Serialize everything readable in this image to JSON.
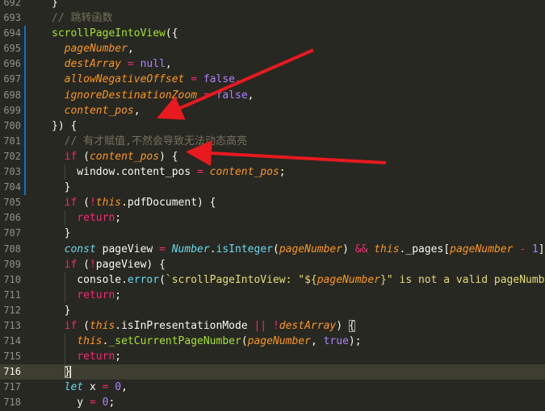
{
  "theme": {
    "background": "#272822",
    "keyword": "#f92672",
    "function": "#a6e22e",
    "param": "#fd971f",
    "constant": "#ae81ff",
    "string": "#e6db74",
    "comment": "#75715e",
    "type": "#66d9ef",
    "arrow": "#e8191f"
  },
  "editor": {
    "current_line": "716",
    "lines": [
      {
        "num": "692",
        "mark": false,
        "guides": [],
        "tokens": [
          {
            "t": "}",
            "c": "#f8f8f2"
          }
        ]
      },
      {
        "num": "693",
        "mark": false,
        "guides": [],
        "tokens": [
          {
            "t": "// 跳转函数",
            "c": "#75715e"
          }
        ]
      },
      {
        "num": "694",
        "mark": true,
        "guides": [],
        "tokens": [
          {
            "t": "scrollPageIntoView",
            "c": "#a6e22e"
          },
          {
            "t": "({",
            "c": "#f8f8f2"
          }
        ]
      },
      {
        "num": "695",
        "mark": true,
        "guides": [],
        "tokens": [
          {
            "t": "  "
          },
          {
            "t": "pageNumber",
            "c": "#fd971f",
            "i": true
          },
          {
            "t": ","
          }
        ]
      },
      {
        "num": "696",
        "mark": true,
        "guides": [],
        "tokens": [
          {
            "t": "  "
          },
          {
            "t": "destArray",
            "c": "#fd971f",
            "i": true
          },
          {
            "t": " = ",
            "c": "#f92672"
          },
          {
            "t": "null",
            "c": "#ae81ff"
          },
          {
            "t": ","
          }
        ]
      },
      {
        "num": "697",
        "mark": true,
        "guides": [],
        "tokens": [
          {
            "t": "  "
          },
          {
            "t": "allowNegativeOffset",
            "c": "#fd971f",
            "i": true
          },
          {
            "t": " = ",
            "c": "#f92672"
          },
          {
            "t": "false",
            "c": "#ae81ff"
          },
          {
            "t": ","
          }
        ]
      },
      {
        "num": "698",
        "mark": true,
        "guides": [],
        "tokens": [
          {
            "t": "  "
          },
          {
            "t": "ignoreDestinationZoom",
            "c": "#fd971f",
            "i": true
          },
          {
            "t": " = ",
            "c": "#f92672"
          },
          {
            "t": "false",
            "c": "#ae81ff"
          },
          {
            "t": ","
          }
        ]
      },
      {
        "num": "699",
        "mark": true,
        "guides": [],
        "tokens": [
          {
            "t": "  "
          },
          {
            "t": "content_pos",
            "c": "#fd971f",
            "i": true
          },
          {
            "t": ","
          }
        ]
      },
      {
        "num": "700",
        "mark": true,
        "guides": [],
        "tokens": [
          {
            "t": "}) {"
          }
        ]
      },
      {
        "num": "701",
        "mark": true,
        "guides": [],
        "tokens": [
          {
            "t": "  "
          },
          {
            "t": "// 有才赋值,不然会导致无法动态高亮",
            "c": "#75715e"
          }
        ]
      },
      {
        "num": "702",
        "mark": true,
        "guides": [],
        "tokens": [
          {
            "t": "  "
          },
          {
            "t": "if",
            "c": "#f92672"
          },
          {
            "t": " ("
          },
          {
            "t": "content_pos",
            "c": "#fd971f",
            "i": true
          },
          {
            "t": ") {"
          }
        ]
      },
      {
        "num": "703",
        "mark": true,
        "guides": [
          1
        ],
        "tokens": [
          {
            "t": "    window.content_pos "
          },
          {
            "t": "=",
            "c": "#f92672"
          },
          {
            "t": " "
          },
          {
            "t": "content_pos",
            "c": "#fd971f",
            "i": true
          },
          {
            "t": ";"
          }
        ]
      },
      {
        "num": "704",
        "mark": true,
        "guides": [],
        "tokens": [
          {
            "t": "  }"
          }
        ]
      },
      {
        "num": "705",
        "mark": false,
        "guides": [],
        "tokens": [
          {
            "t": "  "
          },
          {
            "t": "if",
            "c": "#f92672"
          },
          {
            "t": " ("
          },
          {
            "t": "!",
            "c": "#f92672"
          },
          {
            "t": "this",
            "c": "#fd971f",
            "i": true
          },
          {
            "t": ".pdfDocument) {"
          }
        ]
      },
      {
        "num": "706",
        "mark": false,
        "guides": [
          1
        ],
        "tokens": [
          {
            "t": "    "
          },
          {
            "t": "return",
            "c": "#f92672"
          },
          {
            "t": ";"
          }
        ]
      },
      {
        "num": "707",
        "mark": false,
        "guides": [],
        "tokens": [
          {
            "t": "  }"
          }
        ]
      },
      {
        "num": "708",
        "mark": false,
        "guides": [],
        "tokens": [
          {
            "t": "  "
          },
          {
            "t": "const",
            "c": "#66d9ef",
            "i": true
          },
          {
            "t": " pageView "
          },
          {
            "t": "=",
            "c": "#f92672"
          },
          {
            "t": " "
          },
          {
            "t": "Number",
            "c": "#66d9ef",
            "i": true
          },
          {
            "t": "."
          },
          {
            "t": "isInteger",
            "c": "#66d9ef"
          },
          {
            "t": "("
          },
          {
            "t": "pageNumber",
            "c": "#fd971f",
            "i": true
          },
          {
            "t": ") "
          },
          {
            "t": "&&",
            "c": "#f92672"
          },
          {
            "t": " "
          },
          {
            "t": "this",
            "c": "#fd971f",
            "i": true
          },
          {
            "t": "._pages["
          },
          {
            "t": "pageNumber",
            "c": "#fd971f",
            "i": true
          },
          {
            "t": " - ",
            "c": "#f92672"
          },
          {
            "t": "1",
            "c": "#ae81ff"
          },
          {
            "t": "];"
          }
        ]
      },
      {
        "num": "709",
        "mark": false,
        "guides": [],
        "tokens": [
          {
            "t": "  "
          },
          {
            "t": "if",
            "c": "#f92672"
          },
          {
            "t": " ("
          },
          {
            "t": "!",
            "c": "#f92672"
          },
          {
            "t": "pageView) {"
          }
        ]
      },
      {
        "num": "710",
        "mark": false,
        "guides": [
          1
        ],
        "tokens": [
          {
            "t": "    console."
          },
          {
            "t": "error",
            "c": "#66d9ef"
          },
          {
            "t": "("
          },
          {
            "t": "`scrollPageIntoView: \"${",
            "c": "#e6db74"
          },
          {
            "t": "pageNumber",
            "c": "#fd971f",
            "i": true
          },
          {
            "t": "}\" is not a valid pageNumber",
            "c": "#e6db74"
          }
        ]
      },
      {
        "num": "711",
        "mark": false,
        "guides": [
          1
        ],
        "tokens": [
          {
            "t": "    "
          },
          {
            "t": "return",
            "c": "#f92672"
          },
          {
            "t": ";"
          }
        ]
      },
      {
        "num": "712",
        "mark": false,
        "guides": [],
        "tokens": [
          {
            "t": "  }"
          }
        ]
      },
      {
        "num": "713",
        "mark": false,
        "guides": [],
        "tokens": [
          {
            "t": "  "
          },
          {
            "t": "if",
            "c": "#f92672"
          },
          {
            "t": " ("
          },
          {
            "t": "this",
            "c": "#fd971f",
            "i": true
          },
          {
            "t": ".isInPresentationMode "
          },
          {
            "t": "||",
            "c": "#f92672"
          },
          {
            "t": " "
          },
          {
            "t": "!",
            "c": "#f92672"
          },
          {
            "t": "destArray",
            "c": "#fd971f",
            "i": true
          },
          {
            "t": ") "
          },
          {
            "t": "{",
            "c": "#f8f8f2",
            "box": true
          }
        ]
      },
      {
        "num": "714",
        "mark": false,
        "guides": [
          1
        ],
        "tokens": [
          {
            "t": "    "
          },
          {
            "t": "this",
            "c": "#fd971f",
            "i": true
          },
          {
            "t": "."
          },
          {
            "t": "_setCurrentPageNumber",
            "c": "#a6e22e"
          },
          {
            "t": "("
          },
          {
            "t": "pageNumber",
            "c": "#fd971f",
            "i": true
          },
          {
            "t": ", "
          },
          {
            "t": "true",
            "c": "#ae81ff"
          },
          {
            "t": ");"
          }
        ]
      },
      {
        "num": "715",
        "mark": false,
        "guides": [
          1
        ],
        "tokens": [
          {
            "t": "    "
          },
          {
            "t": "return",
            "c": "#f92672"
          },
          {
            "t": ";"
          }
        ]
      },
      {
        "num": "716",
        "mark": false,
        "guides": [],
        "tokens": [
          {
            "t": "  "
          },
          {
            "t": "}",
            "c": "#f8f8f2",
            "box": true,
            "cursor": true
          }
        ]
      },
      {
        "num": "717",
        "mark": false,
        "guides": [],
        "tokens": [
          {
            "t": "  "
          },
          {
            "t": "let",
            "c": "#66d9ef",
            "i": true
          },
          {
            "t": " x "
          },
          {
            "t": "=",
            "c": "#f92672"
          },
          {
            "t": " "
          },
          {
            "t": "0",
            "c": "#ae81ff"
          },
          {
            "t": ","
          }
        ]
      },
      {
        "num": "718",
        "mark": false,
        "guides": [],
        "tokens": [
          {
            "t": "    y "
          },
          {
            "t": "=",
            "c": "#f92672"
          },
          {
            "t": " "
          },
          {
            "t": "0",
            "c": "#ae81ff"
          },
          {
            "t": ";"
          }
        ]
      }
    ]
  }
}
